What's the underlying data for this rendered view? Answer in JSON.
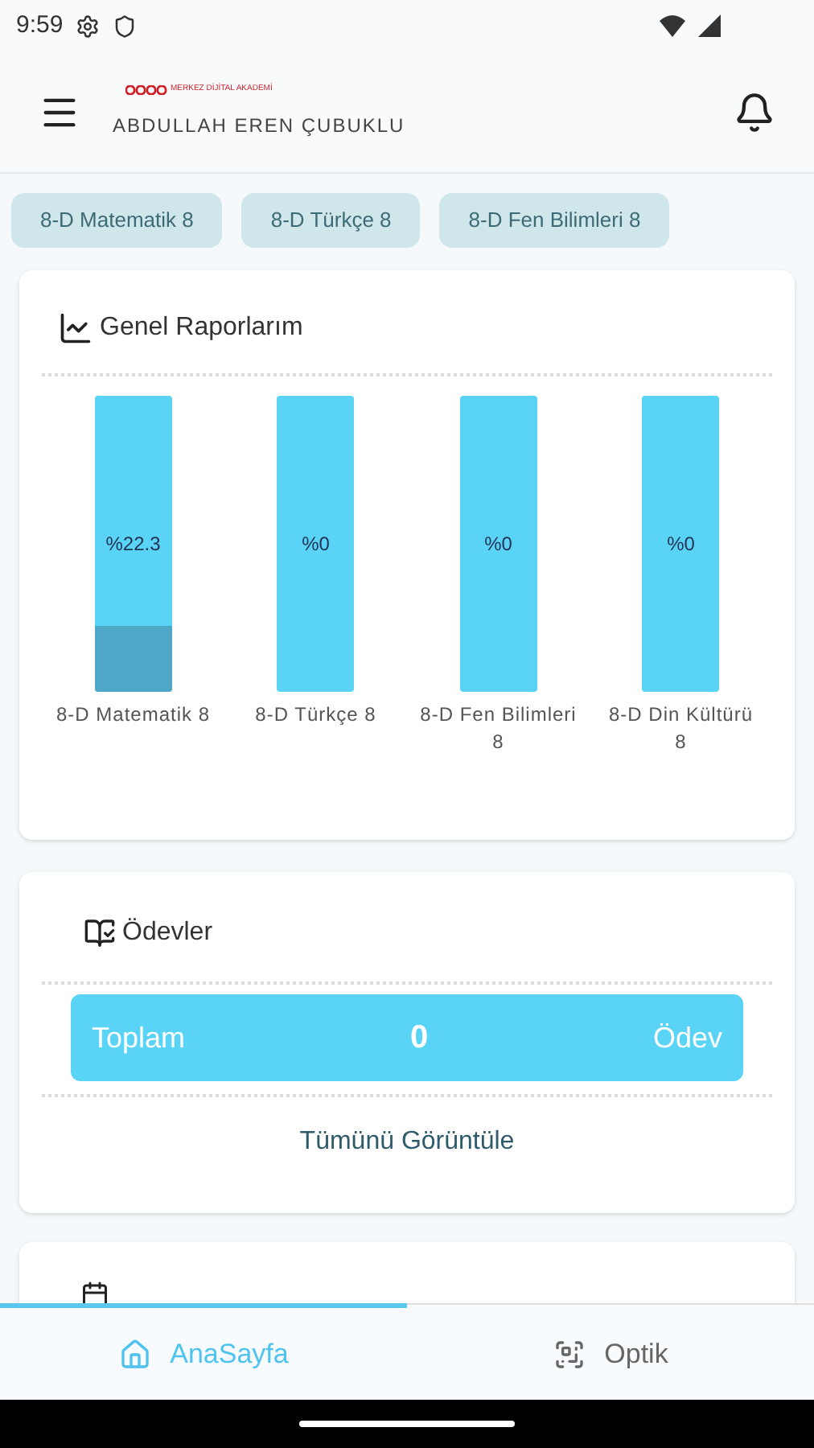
{
  "status_bar": {
    "time": "9:59"
  },
  "header": {
    "logo_text": "MERKEZ DİJİTAL AKADEMİ",
    "user_name": "ABDULLAH EREN ÇUBUKLU"
  },
  "course_tabs": [
    {
      "label": "8-D Matematik 8"
    },
    {
      "label": "8-D Türkçe 8"
    },
    {
      "label": "8-D Fen Bilimleri 8"
    }
  ],
  "reports": {
    "title": "Genel Raporlarım",
    "bars": [
      {
        "label": "8-D Matematik 8",
        "reading": "%22.3",
        "level": 0.223
      },
      {
        "label": "8-D Türkçe 8",
        "reading": "%0"
      },
      {
        "label": "8-D Fen Bilimleri 8",
        "reading": "%0"
      },
      {
        "label": "8-D Din Kültürü 8",
        "reading": "%0"
      }
    ]
  },
  "homework": {
    "title": "Ödevler",
    "total_label": "Toplam",
    "total_count": "0",
    "unit": "Ödev",
    "link": "Tümünü Görüntüle"
  },
  "bottom_nav": [
    {
      "label": "AnaSayfa",
      "kind": "home",
      "selected": true
    },
    {
      "label": "Optik",
      "kind": "scan",
      "selected": false
    }
  ]
}
